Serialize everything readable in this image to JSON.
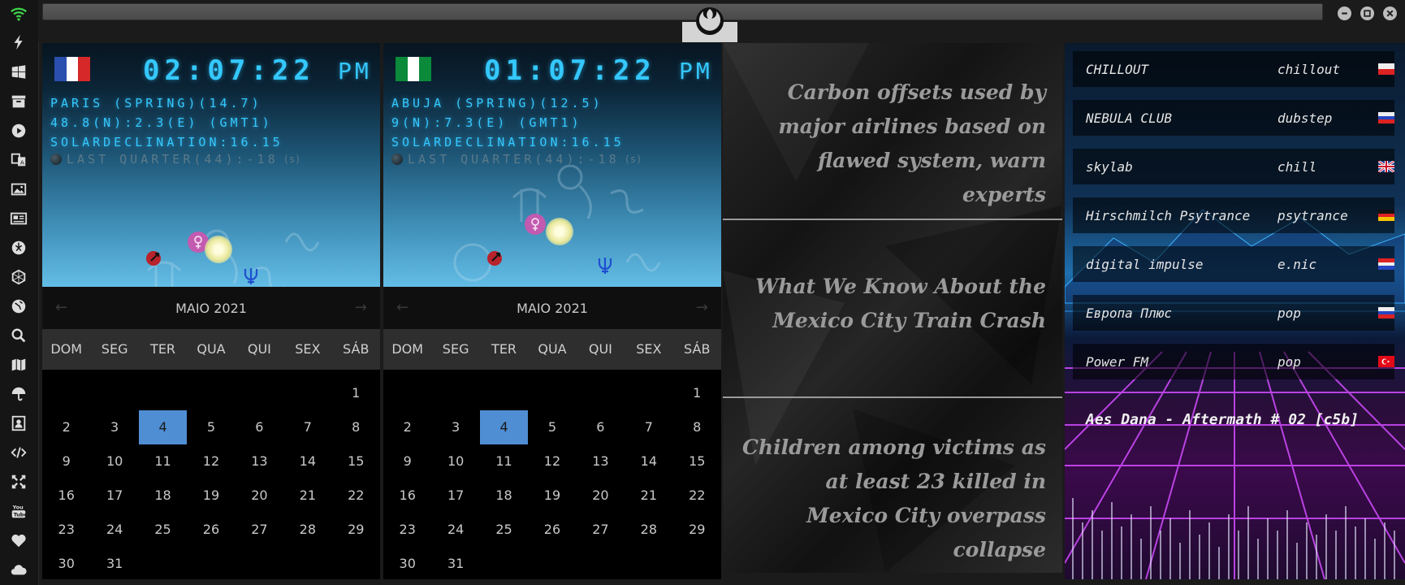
{
  "clocks": [
    {
      "flag": [
        "#2b4fae",
        "#ffffff",
        "#d62828"
      ],
      "time": "02:07:22",
      "ampm": "PM",
      "location": "PARIS (SPRING)(14.7)",
      "coords": "48.8(N):2.3(E) (GMT1)",
      "solar": "SOLARDECLINATION:16.15",
      "moon": "LAST QUARTER(44):-18",
      "moon_unit": "(s)",
      "calendar": {
        "month": "MAIO 2021",
        "weekdays": [
          "DOM",
          "SEG",
          "TER",
          "QUA",
          "QUI",
          "SEX",
          "SÁB"
        ],
        "weeks": [
          [
            "",
            "",
            "",
            "",
            "",
            "",
            "1"
          ],
          [
            "2",
            "3",
            "4",
            "5",
            "6",
            "7",
            "8"
          ],
          [
            "9",
            "10",
            "11",
            "12",
            "13",
            "14",
            "15"
          ],
          [
            "16",
            "17",
            "18",
            "19",
            "20",
            "21",
            "22"
          ],
          [
            "23",
            "24",
            "25",
            "26",
            "27",
            "28",
            "29"
          ],
          [
            "30",
            "31",
            "",
            "",
            "",
            "",
            ""
          ]
        ],
        "today": "4"
      }
    },
    {
      "flag": [
        "#0a8a3a",
        "#ffffff",
        "#0a8a3a"
      ],
      "time": "01:07:22",
      "ampm": "PM",
      "location": "ABUJA (SPRING)(12.5)",
      "coords": "9(N):7.3(E) (GMT1)",
      "solar": "SOLARDECLINATION:16.15",
      "moon": "LAST QUARTER(44):-18",
      "moon_unit": "(s)",
      "calendar": {
        "month": "MAIO 2021",
        "weekdays": [
          "DOM",
          "SEG",
          "TER",
          "QUA",
          "QUI",
          "SEX",
          "SÁB"
        ],
        "weeks": [
          [
            "",
            "",
            "",
            "",
            "",
            "",
            "1"
          ],
          [
            "2",
            "3",
            "4",
            "5",
            "6",
            "7",
            "8"
          ],
          [
            "9",
            "10",
            "11",
            "12",
            "13",
            "14",
            "15"
          ],
          [
            "16",
            "17",
            "18",
            "19",
            "20",
            "21",
            "22"
          ],
          [
            "23",
            "24",
            "25",
            "26",
            "27",
            "28",
            "29"
          ],
          [
            "30",
            "31",
            "",
            "",
            "",
            "",
            ""
          ]
        ],
        "today": "4"
      }
    }
  ],
  "news": [
    "Carbon offsets used by major airlines based on flawed system, warn experts",
    "What We Know About the Mexico City Train Crash",
    "Children among victims as at least 23 killed in Mexico City overpass collapse"
  ],
  "radio": {
    "stations": [
      {
        "name": "CHILLOUT",
        "genre": "chillout",
        "flag": "pl"
      },
      {
        "name": "NEBULA CLUB",
        "genre": "dubstep",
        "flag": "ru"
      },
      {
        "name": "skylab",
        "genre": "chill",
        "flag": "uk"
      },
      {
        "name": "Hirschmilch Psytrance",
        "genre": "psytrance",
        "flag": "de"
      },
      {
        "name": "digital impulse",
        "genre": "e.nic",
        "flag": "hr"
      },
      {
        "name": "Европа Плюс",
        "genre": "pop",
        "flag": "ru"
      },
      {
        "name": "Power FM",
        "genre": "pop",
        "flag": "tr"
      }
    ],
    "now_playing": "Aes Dana - Aftermath # 02 [c5b]"
  },
  "sidebar_icons": [
    "wifi-icon",
    "lightning-icon",
    "windows-icon",
    "archive-icon",
    "play-icon",
    "translate-icon",
    "image-icon",
    "news-icon",
    "rebel-icon",
    "hexagon-icon",
    "globe-icon",
    "search-icon",
    "map-icon",
    "umbrella-icon",
    "contact-icon",
    "code-icon",
    "expand-icon",
    "youtube-icon",
    "heart-icon",
    "cloud-icon"
  ],
  "colors": {
    "lcd": "#34c8ff",
    "today": "#4f8ed3",
    "wifi": "#3fd44a"
  }
}
